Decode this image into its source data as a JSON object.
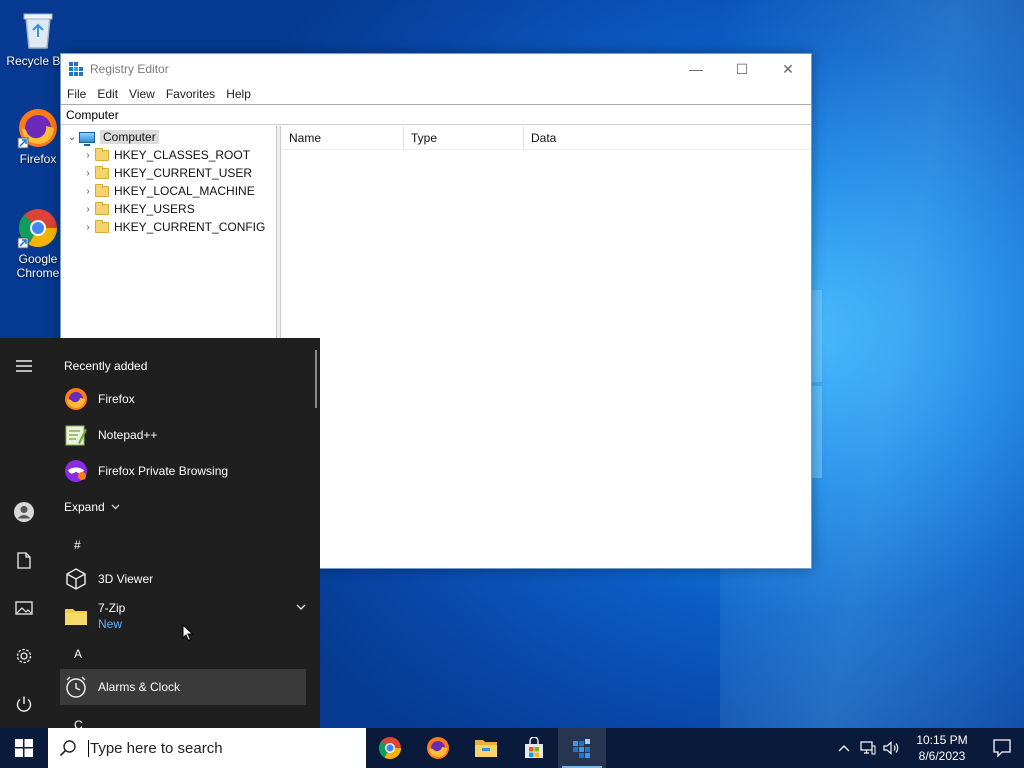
{
  "desktop": {
    "icons": [
      {
        "label": "Recycle Bin",
        "icon": "recycle-bin-icon"
      },
      {
        "label": "Firefox",
        "icon": "firefox-icon"
      },
      {
        "label": "Google Chrome",
        "icon": "chrome-icon"
      }
    ]
  },
  "regedit": {
    "title": "Registry Editor",
    "caption": {
      "minimize": "—",
      "maximize": "☐",
      "close": "✕"
    },
    "menu": [
      "File",
      "Edit",
      "View",
      "Favorites",
      "Help"
    ],
    "address": "Computer",
    "tree": {
      "root": "Computer",
      "children": [
        "HKEY_CLASSES_ROOT",
        "HKEY_CURRENT_USER",
        "HKEY_LOCAL_MACHINE",
        "HKEY_USERS",
        "HKEY_CURRENT_CONFIG"
      ]
    },
    "columns": [
      "Name",
      "Type",
      "Data"
    ]
  },
  "start_menu": {
    "recently_added_label": "Recently added",
    "recent": [
      {
        "label": "Firefox",
        "icon": "firefox-icon"
      },
      {
        "label": "Notepad++",
        "icon": "notepadpp-icon"
      },
      {
        "label": "Firefox Private Browsing",
        "icon": "firefox-private-icon"
      }
    ],
    "expand_label": "Expand",
    "letter_hash": "#",
    "app_3d_viewer": "3D Viewer",
    "app_7zip": "7-Zip",
    "app_7zip_badge": "New",
    "letter_a": "A",
    "app_alarms": "Alarms & Clock",
    "letter_c": "C",
    "rail": [
      "menu-icon",
      "user-icon",
      "documents-icon",
      "pictures-icon",
      "settings-icon",
      "power-icon"
    ]
  },
  "taskbar": {
    "search_placeholder": "Type here to search",
    "apps": [
      "chrome-icon",
      "firefox-icon",
      "file-explorer-icon",
      "store-icon",
      "regedit-icon"
    ],
    "time": "10:15 PM",
    "date": "8/6/2023"
  }
}
